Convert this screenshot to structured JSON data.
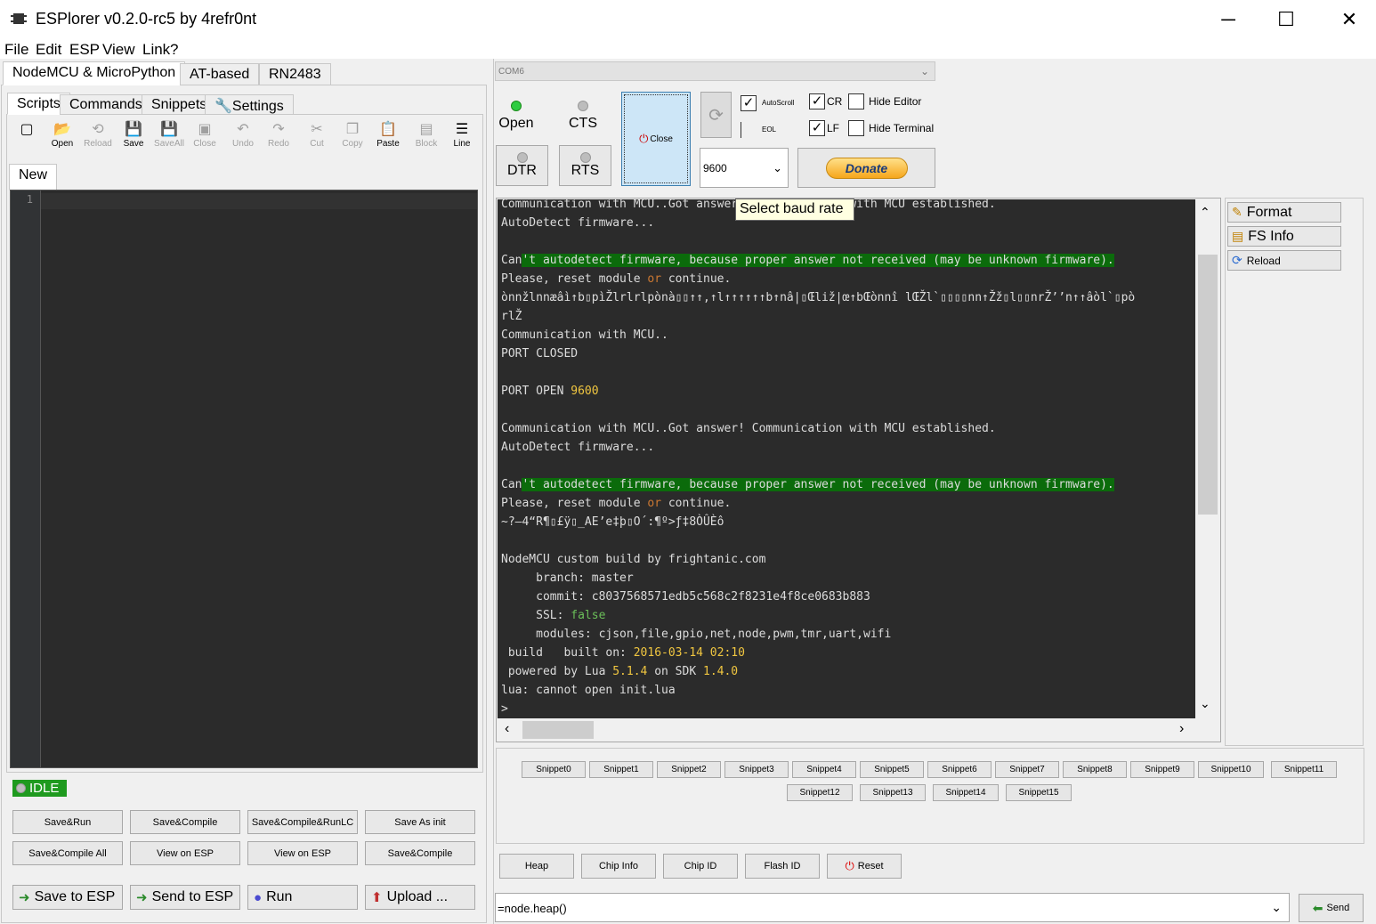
{
  "window": {
    "title": "ESPlorer v0.2.0-rc5 by 4refr0nt",
    "minimize": "─",
    "maximize": "☐",
    "close": "✕"
  },
  "menu": [
    "File",
    "Edit",
    "ESP",
    "View",
    "Link",
    "?"
  ],
  "left_tabs": [
    "NodeMCU & MicroPython",
    "AT-based",
    "RN2483"
  ],
  "sub_tabs": [
    "Scripts",
    "Commands",
    "Snippets",
    "Settings"
  ],
  "toolbar": [
    {
      "label": "",
      "icon": "new-file-icon",
      "glyph": "▢",
      "disabled": false
    },
    {
      "label": "Open",
      "icon": "folder-open-icon",
      "glyph": "📂",
      "disabled": false
    },
    {
      "label": "Reload",
      "icon": "reload-icon",
      "glyph": "⟲",
      "disabled": true
    },
    {
      "label": "Save",
      "icon": "save-icon",
      "glyph": "💾",
      "disabled": false
    },
    {
      "label": "SaveAll",
      "icon": "save-all-icon",
      "glyph": "💾",
      "disabled": true
    },
    {
      "label": "Close",
      "icon": "close-file-icon",
      "glyph": "▣",
      "disabled": true
    },
    {
      "label": "Undo",
      "icon": "undo-icon",
      "glyph": "↶",
      "disabled": true
    },
    {
      "label": "Redo",
      "icon": "redo-icon",
      "glyph": "↷",
      "disabled": true
    },
    {
      "label": "Cut",
      "icon": "cut-icon",
      "glyph": "✂",
      "disabled": true
    },
    {
      "label": "Copy",
      "icon": "copy-icon",
      "glyph": "❐",
      "disabled": true
    },
    {
      "label": "Paste",
      "icon": "paste-icon",
      "glyph": "📋",
      "disabled": false
    },
    {
      "label": "Block",
      "icon": "block-icon",
      "glyph": "▤",
      "disabled": true
    },
    {
      "label": "Line",
      "icon": "line-icon",
      "glyph": "☰",
      "disabled": false
    }
  ],
  "file_tab": "New",
  "editor": {
    "line_number": "1"
  },
  "status": "IDLE",
  "left_buttons_row1": [
    "Save&Run",
    "Save&Compile",
    "Save&Compile&RunLC",
    "Save As init"
  ],
  "left_buttons_row2": [
    "Save&Compile All",
    "View on ESP",
    "View on ESP",
    "Save&Compile"
  ],
  "left_buttons_big": [
    {
      "label": "Save to ESP",
      "icon": "save-to-esp-icon",
      "glyph": "➜"
    },
    {
      "label": "Send to ESP",
      "icon": "send-to-esp-icon",
      "glyph": "➜"
    },
    {
      "label": "Run",
      "icon": "run-icon",
      "glyph": "●"
    },
    {
      "label": "Upload ...",
      "icon": "upload-icon",
      "glyph": "⬆"
    }
  ],
  "port": {
    "value": "COM6"
  },
  "signals": {
    "open": "Open",
    "cts": "CTS",
    "dtr": "DTR",
    "rts": "RTS"
  },
  "close_button": "Close",
  "baud": {
    "value": "9600",
    "tooltip": "Select baud rate"
  },
  "options": {
    "autoscroll": "AutoScroll",
    "eol": "EOL",
    "cr": "CR",
    "lf": "LF",
    "hide_editor": "Hide Editor",
    "hide_terminal": "Hide Terminal"
  },
  "donate": "Donate",
  "terminal_lines": [
    "Communication with MCU..Got answer! Communication with MCU established.",
    "AutoDetect firmware...",
    "",
    "Can't autodetect firmware, because proper answer not received (may be unknown firmware).",
    "Please, reset module or continue.",
    "ònnžlnnæâì↑b▯pìŽlrlrlpònà▯▯↑↑,↑l↑↑↑↑↑↑b↑nâ|▯Œliž|œ↑bŒònnî lŒŽl`▯▯▯▯nn↑Žž▯l▯▯nrŽ’’n↑↑âòl`▯pò",
    "rlŽ",
    "Communication with MCU..",
    "PORT CLOSED",
    "",
    "PORT OPEN 9600",
    "",
    "Communication with MCU..Got answer! Communication with MCU established.",
    "AutoDetect firmware...",
    "",
    "Can't autodetect firmware, because proper answer not received (may be unknown firmware).",
    "Please, reset module or continue.",
    "~?–4“R¶▯£ÿ▯_AE’e‡þ▯O´:¶º>ƒ‡8ÒÛÈô",
    "",
    "NodeMCU custom build by frightanic.com",
    "     branch: master",
    "     commit: c8037568571edb5c568c2f8231e4f8ce0683b883",
    "     SSL: false",
    "     modules: cjson,file,gpio,net,node,pwm,tmr,uart,wifi",
    " build   built on: 2016-03-14 02:10",
    " powered by Lua 5.1.4 on SDK 1.4.0",
    "lua: cannot open init.lua",
    ">"
  ],
  "side_buttons": [
    {
      "label": "Format",
      "icon": "format-icon",
      "glyph": "✎"
    },
    {
      "label": "FS Info",
      "icon": "fs-info-icon",
      "glyph": "▤"
    },
    {
      "label": "Reload",
      "icon": "reload-icon",
      "glyph": "⟳"
    }
  ],
  "snippets": [
    "Snippet0",
    "Snippet1",
    "Snippet2",
    "Snippet3",
    "Snippet4",
    "Snippet5",
    "Snippet6",
    "Snippet7",
    "Snippet8",
    "Snippet9",
    "Snippet10",
    "Snippet11",
    "Snippet12",
    "Snippet13",
    "Snippet14",
    "Snippet15"
  ],
  "bottom_buttons": [
    "Heap",
    "Chip Info",
    "Chip ID",
    "Flash ID",
    "Reset"
  ],
  "command": {
    "value": "=node.heap()"
  },
  "send": "Send",
  "colors": {
    "terminal_bg": "#2b2b2b",
    "highlight": "#0b6b0b",
    "number": "#f0c640",
    "idle_green": "#1f9a1f"
  }
}
